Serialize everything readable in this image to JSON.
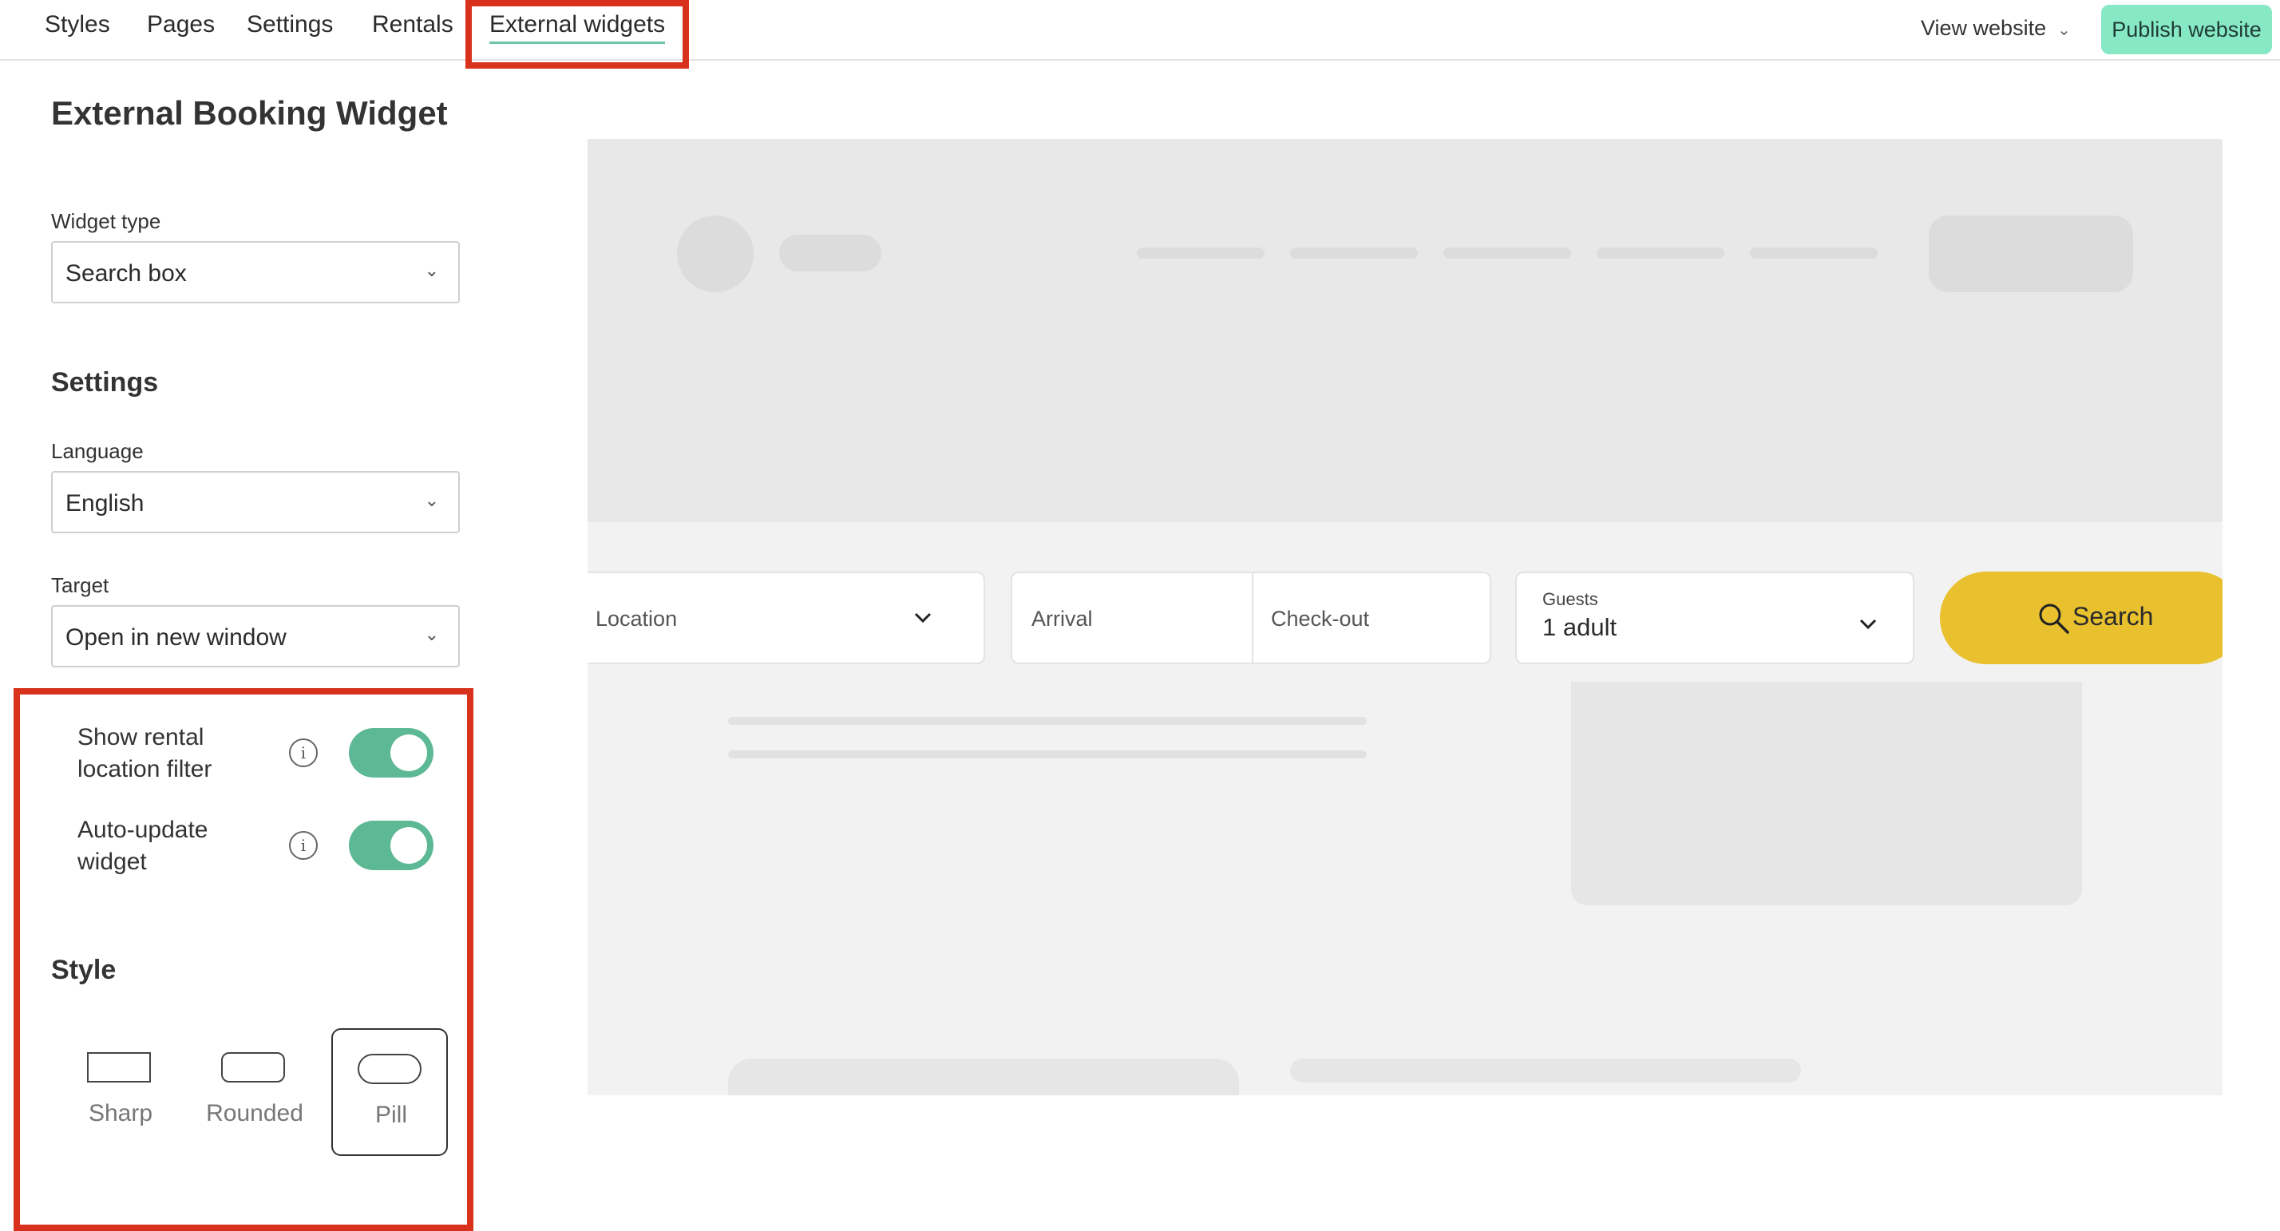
{
  "nav": {
    "tabs": [
      {
        "label": "Styles"
      },
      {
        "label": "Pages"
      },
      {
        "label": "Settings"
      },
      {
        "label": "Rentals"
      },
      {
        "label": "External widgets"
      }
    ],
    "active_tab": "External widgets",
    "view_website": "View website",
    "publish": "Publish website"
  },
  "panel": {
    "title": "External Booking Widget",
    "widget_type": {
      "label": "Widget type",
      "value": "Search box"
    },
    "settings_heading": "Settings",
    "language": {
      "label": "Language",
      "value": "English"
    },
    "target": {
      "label": "Target",
      "value": "Open in new window"
    },
    "toggles": [
      {
        "label_line1": "Show rental",
        "label_line2": "location filter",
        "on": true
      },
      {
        "label_line1": "Auto-update",
        "label_line2": "widget",
        "on": true
      }
    ],
    "style_heading": "Style",
    "styles": [
      {
        "name": "Sharp",
        "selected": false
      },
      {
        "name": "Rounded",
        "selected": false
      },
      {
        "name": "Pill",
        "selected": true
      }
    ]
  },
  "preview": {
    "location_placeholder": "Location",
    "arrival_placeholder": "Arrival",
    "checkout_placeholder": "Check-out",
    "guests_label": "Guests",
    "guests_value": "1 adult",
    "search_label": "Search"
  },
  "colors": {
    "accent_green": "#5db895",
    "publish_bg": "#86e8c4",
    "search_yellow": "#e9c12f",
    "highlight_red": "#d8321c"
  }
}
